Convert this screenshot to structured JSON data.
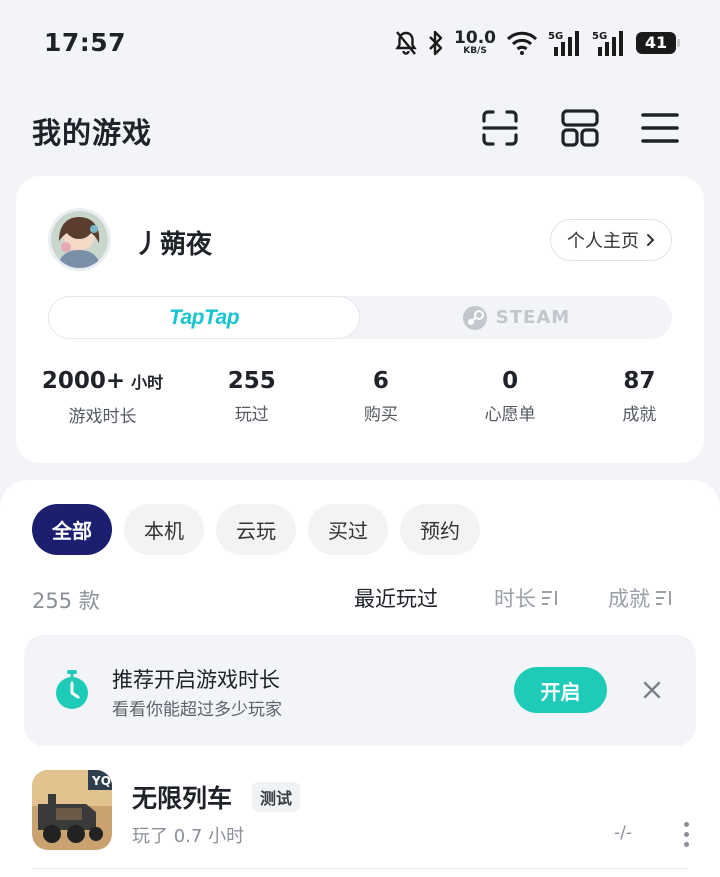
{
  "status_bar": {
    "time": "17:57",
    "net_speed_value": "10.0",
    "net_speed_unit": "KB/S",
    "signal_1_label": "5G",
    "signal_2_label": "5G",
    "battery_level": "41",
    "icons": [
      "mute-icon",
      "bluetooth-icon",
      "wifi-icon",
      "signal-icon",
      "battery-icon"
    ]
  },
  "header": {
    "title": "我的游戏",
    "actions": [
      "scan-icon",
      "grid-icon",
      "menu-icon"
    ]
  },
  "profile": {
    "username": "丿蒴夜",
    "home_button": "个人主页",
    "platforms": [
      {
        "label": "TapTap",
        "active": true
      },
      {
        "label": "STEAM",
        "active": false
      }
    ],
    "stats": [
      {
        "value": "2000+",
        "unit": "小时",
        "label": "游戏时长"
      },
      {
        "value": "255",
        "label": "玩过"
      },
      {
        "value": "6",
        "label": "购买"
      },
      {
        "value": "0",
        "label": "心愿单"
      },
      {
        "value": "87",
        "label": "成就"
      }
    ]
  },
  "filters": {
    "chips": [
      "全部",
      "本机",
      "云玩",
      "买过",
      "预约"
    ],
    "active": "全部"
  },
  "list_header": {
    "count": "255 款",
    "sort_recent": "最近玩过",
    "sort_duration": "时长",
    "sort_achievement": "成就"
  },
  "banner": {
    "title": "推荐开启游戏时长",
    "subtitle": "看看你能超过多少玩家",
    "button": "开启"
  },
  "games": [
    {
      "name": "无限列车",
      "tag": "测试",
      "play_time": "玩了 0.7 小时",
      "rating": "-/-"
    }
  ],
  "colors": {
    "accent_teal": "#1ecbb9",
    "chip_active": "#1c1f6f",
    "taptap_brand": "#15c5ce"
  }
}
